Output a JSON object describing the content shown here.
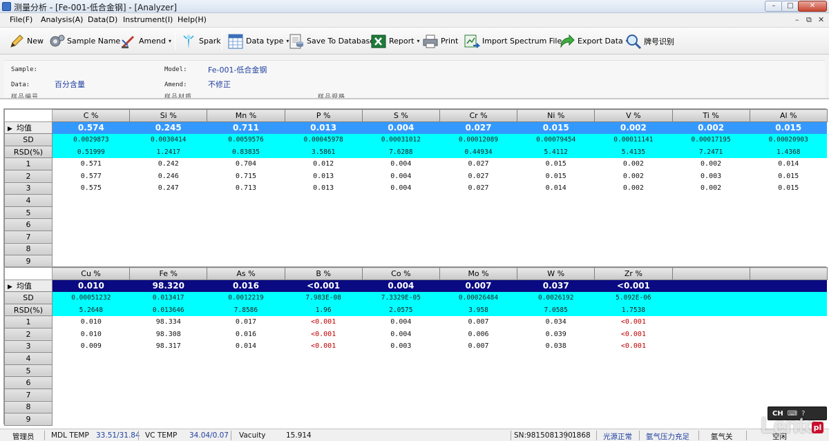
{
  "window": {
    "title": "测量分析 - [Fe-001-低合金钢] - [Analyzer]",
    "min_label": "–",
    "max_label": "□",
    "close_label": "✕"
  },
  "menu": {
    "items": [
      "File(F)",
      "Analysis(A)",
      "Data(D)",
      "Instrument(I)",
      "Help(H)"
    ],
    "mdi_min": "–",
    "mdi_restore": "⧉",
    "mdi_close": "✕"
  },
  "toolbar": {
    "new": "New",
    "sample_name": "Sample Name",
    "amend": "Amend",
    "spark": "Spark",
    "data_type": "Data type",
    "save_db": "Save To Database",
    "report": "Report",
    "print": "Print",
    "import": "Import Spectrum File",
    "export": "Export Data",
    "grade": "牌号识别",
    "caret": "▾"
  },
  "info": {
    "sample_label": "Sample:",
    "data_label": "Data:",
    "data_value": "百分含量",
    "model_label": "Model:",
    "model_value": "Fe-001-低合金钢",
    "amend_label": "Amend:",
    "amend_value": "不修正",
    "cut1": "样品编号",
    "cut2": "样品材质",
    "cut3": "样品规格"
  },
  "grid_top": {
    "columns": [
      "C %",
      "Si %",
      "Mn %",
      "P %",
      "S %",
      "Cr %",
      "Ni %",
      "V %",
      "Ti %",
      "Al %"
    ],
    "avg_label": "均值",
    "avg": [
      "0.574",
      "0.245",
      "0.711",
      "0.013",
      "0.004",
      "0.027",
      "0.015",
      "0.002",
      "0.002",
      "0.015"
    ],
    "sd_label": "SD",
    "sd": [
      "0.0029873",
      "0.0030414",
      "0.0059576",
      "0.00045978",
      "0.00031012",
      "0.00012089",
      "0.00079454",
      "0.00011141",
      "0.00017195",
      "0.00020903"
    ],
    "rsd_label": "RSD(%)",
    "rsd": [
      "0.51999",
      "1.2417",
      "0.83835",
      "3.5861",
      "7.6288",
      "0.44934",
      "5.4112",
      "5.4135",
      "7.2471",
      "1.4368"
    ],
    "rows": [
      {
        "n": "1",
        "v": [
          "0.571",
          "0.242",
          "0.704",
          "0.012",
          "0.004",
          "0.027",
          "0.015",
          "0.002",
          "0.002",
          "0.014"
        ]
      },
      {
        "n": "2",
        "v": [
          "0.577",
          "0.246",
          "0.715",
          "0.013",
          "0.004",
          "0.027",
          "0.015",
          "0.002",
          "0.003",
          "0.015"
        ]
      },
      {
        "n": "3",
        "v": [
          "0.575",
          "0.247",
          "0.713",
          "0.013",
          "0.004",
          "0.027",
          "0.014",
          "0.002",
          "0.002",
          "0.015"
        ]
      }
    ],
    "empty_rows": [
      "4",
      "5",
      "6",
      "7",
      "8",
      "9"
    ]
  },
  "grid_bottom": {
    "columns": [
      "Cu %",
      "Fe %",
      "As %",
      "B %",
      "Co %",
      "Mo %",
      "W %",
      "Zr %",
      "",
      ""
    ],
    "avg_label": "均值",
    "avg": [
      "0.010",
      "98.320",
      "0.016",
      "<0.001",
      "0.004",
      "0.007",
      "0.037",
      "<0.001",
      "",
      ""
    ],
    "sd_label": "SD",
    "sd": [
      "0.00051232",
      "0.013417",
      "0.0012219",
      "7.983E-08",
      "7.3329E-05",
      "0.00026484",
      "0.0026192",
      "5.092E-06",
      "",
      ""
    ],
    "rsd_label": "RSD(%)",
    "rsd": [
      "5.2648",
      "0.013646",
      "7.8586",
      "1.96",
      "2.0575",
      "3.958",
      "7.0585",
      "1.7538",
      "",
      ""
    ],
    "rows": [
      {
        "n": "1",
        "v": [
          "0.010",
          "98.334",
          "0.017",
          "<0.001",
          "0.004",
          "0.007",
          "0.034",
          "<0.001",
          "",
          ""
        ]
      },
      {
        "n": "2",
        "v": [
          "0.010",
          "98.308",
          "0.016",
          "<0.001",
          "0.004",
          "0.006",
          "0.039",
          "<0.001",
          "",
          ""
        ]
      },
      {
        "n": "3",
        "v": [
          "0.009",
          "98.317",
          "0.014",
          "<0.001",
          "0.003",
          "0.007",
          "0.038",
          "<0.001",
          "",
          ""
        ]
      }
    ],
    "empty_rows": [
      "4",
      "5",
      "6",
      "7",
      "8",
      "9"
    ]
  },
  "status": {
    "user": "管理员",
    "mdl_label": "MDL TEMP",
    "mdl_value": "33.51/31.84",
    "vc_label": "VC TEMP",
    "vc_value": "34.04/0.07",
    "vacuity_label": "Vacuity",
    "vacuity_value": "15.914",
    "sn": "SN:9815081390",
    "count": "1868",
    "light": "光源正常",
    "argon_pressure": "氩气压力充足",
    "argon": "氩气关",
    "idle": "空闲"
  },
  "ime": {
    "lang": "CH"
  },
  "watermark": {
    "text": "Lento",
    "badge": "pl"
  },
  "colors": {
    "avg_top": "#3399ff",
    "avg_bottom": "#0a0a82",
    "stats_bg": "#00ffff",
    "below_limit": "#c00000"
  }
}
